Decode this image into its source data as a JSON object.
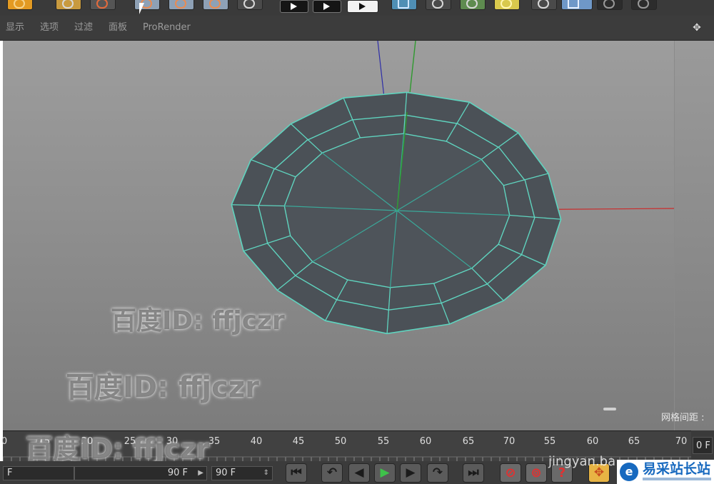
{
  "menubar": {
    "items": [
      "显示",
      "选项",
      "过滤",
      "面板",
      "ProRender"
    ]
  },
  "viewport": {
    "grid_spacing_label": "网格间距 :",
    "colors": {
      "background": "#8f8f8f",
      "mesh_face": "#4b5157",
      "mesh_edge": "#5fd4bf",
      "axis_x": "#cc2b2b",
      "axis_y": "#2f9a2f",
      "axis_z": "#2e2ea8"
    }
  },
  "watermarks": [
    "百度ID: ffjczr",
    "百度ID: ffjczr",
    "百度ID: ffjczr"
  ],
  "timeline": {
    "tick_labels": [
      "0",
      "15",
      "20",
      "25",
      "30",
      "35",
      "40",
      "45",
      "50",
      "55",
      "60",
      "65",
      "70",
      "55",
      "60",
      "65",
      "70"
    ],
    "frame_field": "0 F"
  },
  "controls": {
    "start_frame": "F",
    "end_frame": "90 F",
    "end_frame_2": "90 F"
  },
  "site": {
    "logo_glyph": "e",
    "name": "易采站长站",
    "overlay_text": "jingyan.ba"
  }
}
